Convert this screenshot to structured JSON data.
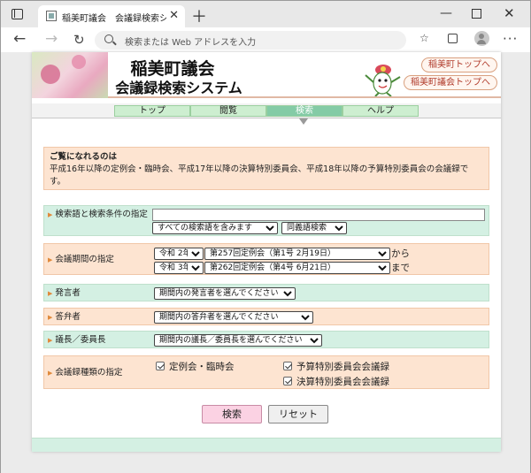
{
  "browser": {
    "tab_title": "稲美町議会　会議録検索システム",
    "address_placeholder": "検索または Web アドレスを入力",
    "icons": [
      "window-menu-icon",
      "close-icon",
      "new-tab-icon",
      "back-icon",
      "forward-icon",
      "refresh-icon",
      "search-icon",
      "favorites-icon",
      "collections-icon",
      "profile-icon",
      "more-icon"
    ]
  },
  "header": {
    "title": "稲美町議会",
    "subtitle": "会議録検索システム",
    "links": [
      "稲美町トップへ",
      "稲美町議会トップへ"
    ]
  },
  "menu": {
    "items": [
      "トップ",
      "閲覧",
      "検索",
      "ヘルプ"
    ],
    "active": "検索"
  },
  "notice": {
    "title": "ご覧になれるのは",
    "body": "平成16年以降の定例会・臨時会、平成17年以降の決算特別委員会、平成18年以降の予算特別委員会の会議録です。"
  },
  "form": {
    "keyword": {
      "label": "検索語と検索条件の指定",
      "value": "",
      "condition": "すべての検索語を含みます",
      "synonym": "同義語検索"
    },
    "period": {
      "label": "会議期間の指定",
      "from_year": "令和 2年",
      "from_meeting": "第257回定例会（第1号 2月19日）",
      "from_suffix": "から",
      "to_year": "令和 3年",
      "to_meeting": "第262回定例会（第4号 6月21日）",
      "to_suffix": "まで"
    },
    "speaker": {
      "label": "発言者",
      "value": "期間内の発言者を選んでください"
    },
    "answerer": {
      "label": "答弁者",
      "value": "期間内の答弁者を選んでください"
    },
    "chair": {
      "label": "議長／委員長",
      "value": "期間内の議長／委員長を選んでください"
    },
    "meeting_type": {
      "label": "会議録種類の指定",
      "options": [
        {
          "label": "定例会・臨時会",
          "checked": true
        },
        {
          "label": "予算特別委員会会議録",
          "checked": true
        },
        {
          "label": "決算特別委員会会議録",
          "checked": true
        }
      ]
    }
  },
  "buttons": {
    "search": "検索",
    "reset": "リセット"
  },
  "colors": {
    "row_green": "#d4f0e3",
    "row_peach": "#fde4d1",
    "search_button": "#fbd2e3",
    "link_text": "#b03a2a"
  }
}
